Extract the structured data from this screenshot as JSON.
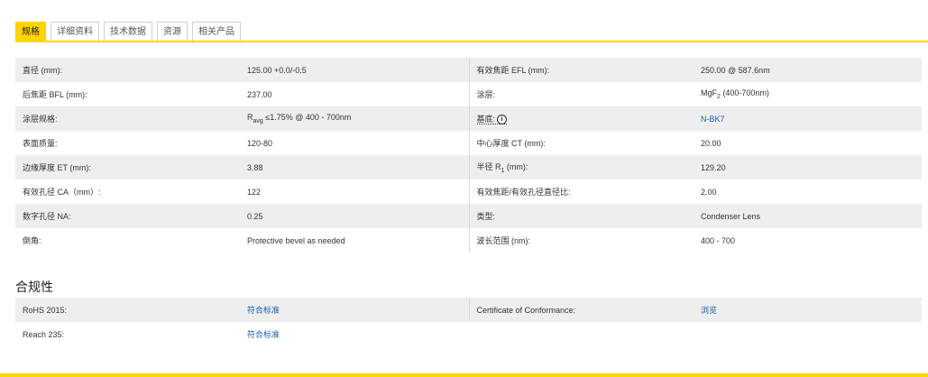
{
  "tabs": [
    "规格",
    "详细资料",
    "技术数据",
    "资源",
    "相关产品"
  ],
  "specs": [
    {
      "l1": "直径 (mm):",
      "v1": "125.00 +0.0/-0.5",
      "l2": "有效焦距 EFL (mm):",
      "v2": "250.00 @ 587.6nm"
    },
    {
      "l1": "后焦距 BFL (mm):",
      "v1": "237.00",
      "l2": "涂层:",
      "v2_pre": "MgF",
      "v2_sub": "2",
      "v2_post": " (400-700nm)"
    },
    {
      "l1": "涂层规格:",
      "v1_pre": "R",
      "v1_sub": "avg",
      "v1_post": " ≤1.75% @ 400 - 700nm",
      "l2": "基底:",
      "l2_icon": "i",
      "v2": "N-BK7"
    },
    {
      "l1": "表面质量:",
      "v1": "120-80",
      "l2": "中心厚度 CT (mm):",
      "v2": "20.00"
    },
    {
      "l1": "边缘厚度 ET (mm):",
      "v1": "3.88",
      "l2_pre": "半径 R",
      "l2_sub": "1",
      "l2_post": " (mm):",
      "v2": "129.20"
    },
    {
      "l1": "有效孔径 CA（mm）:",
      "v1": "122",
      "l2": "有效焦距/有效孔径直径比:",
      "v2": "2.00"
    },
    {
      "l1": "数字孔径 NA:",
      "v1": "0.25",
      "l2": "类型:",
      "v2": "Condenser Lens"
    },
    {
      "l1": "倒角:",
      "v1": "Protective bevel as needed",
      "l2": "波长范围 (nm):",
      "v2": "400 - 700"
    }
  ],
  "compliance": {
    "title": "合规性",
    "rows": [
      {
        "l1": "RoHS 2015:",
        "v1": "符合标准",
        "l2": "Certificate of Conformance:",
        "v2": "浏览"
      },
      {
        "l1": "Reach 235:",
        "v1": "符合标准"
      }
    ]
  },
  "colors": {
    "accent": "#ffd400",
    "link": "#1d5fa8"
  }
}
